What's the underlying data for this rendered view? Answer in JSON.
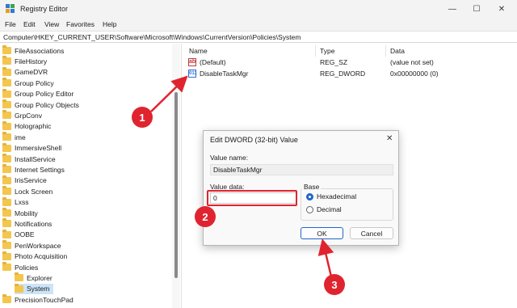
{
  "window": {
    "title": "Registry Editor",
    "controls": {
      "minimize": "—",
      "maximize": "☐",
      "close": "✕"
    }
  },
  "menu": [
    "File",
    "Edit",
    "View",
    "Favorites",
    "Help"
  ],
  "address": "Computer\\HKEY_CURRENT_USER\\Software\\Microsoft\\Windows\\CurrentVersion\\Policies\\System",
  "tree": {
    "items": [
      {
        "label": "FileAssociations",
        "level": 0
      },
      {
        "label": "FileHistory",
        "level": 0
      },
      {
        "label": "GameDVR",
        "level": 0
      },
      {
        "label": "Group Policy",
        "level": 0
      },
      {
        "label": "Group Policy Editor",
        "level": 0
      },
      {
        "label": "Group Policy Objects",
        "level": 0
      },
      {
        "label": "GrpConv",
        "level": 0
      },
      {
        "label": "Holographic",
        "level": 0
      },
      {
        "label": "ime",
        "level": 0
      },
      {
        "label": "ImmersiveShell",
        "level": 0
      },
      {
        "label": "InstallService",
        "level": 0
      },
      {
        "label": "Internet Settings",
        "level": 0
      },
      {
        "label": "IrisService",
        "level": 0
      },
      {
        "label": "Lock Screen",
        "level": 0
      },
      {
        "label": "Lxss",
        "level": 0
      },
      {
        "label": "Mobility",
        "level": 0
      },
      {
        "label": "Notifications",
        "level": 0
      },
      {
        "label": "OOBE",
        "level": 0
      },
      {
        "label": "PenWorkspace",
        "level": 0
      },
      {
        "label": "Photo Acquisition",
        "level": 0
      },
      {
        "label": "Policies",
        "level": 0
      },
      {
        "label": "Explorer",
        "level": 1
      },
      {
        "label": "System",
        "level": 1,
        "selected": true
      },
      {
        "label": "PrecisionTouchPad",
        "level": 0
      }
    ]
  },
  "list": {
    "columns": {
      "name": "Name",
      "type": "Type",
      "data": "Data"
    },
    "rows": [
      {
        "name": "(Default)",
        "type": "REG_SZ",
        "data": "(value not set)",
        "icon": "string-value-icon",
        "icon_glyph": "ab"
      },
      {
        "name": "DisableTaskMgr",
        "type": "REG_DWORD",
        "data": "0x00000000 (0)",
        "icon": "dword-value-icon",
        "icon_glyph": "011"
      }
    ]
  },
  "dialog": {
    "title": "Edit DWORD (32-bit) Value",
    "close": "✕",
    "value_name_label": "Value name:",
    "value_name": "DisableTaskMgr",
    "value_data_label": "Value data:",
    "value_data": "0",
    "base_label": "Base",
    "base_options": [
      {
        "label": "Hexadecimal",
        "checked": true
      },
      {
        "label": "Decimal",
        "checked": false
      }
    ],
    "ok_label": "OK",
    "cancel_label": "Cancel"
  },
  "annotations": {
    "step1": "1",
    "step2": "2",
    "step3": "3",
    "color": "#e0242f"
  }
}
